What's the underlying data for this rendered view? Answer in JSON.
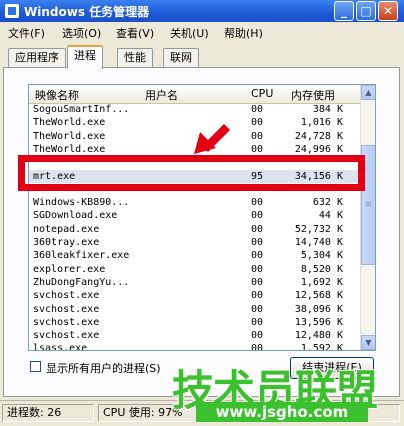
{
  "window": {
    "title": "Windows 任务管理器",
    "minimize_glyph": "_",
    "maximize_glyph": "□",
    "close_glyph": "✕"
  },
  "menu": [
    "文件(F)",
    "选项(O)",
    "查看(V)",
    "关机(U)",
    "帮助(H)"
  ],
  "tabs": [
    {
      "label": "应用程序",
      "active": false
    },
    {
      "label": "进程",
      "active": true
    },
    {
      "label": "性能",
      "active": false
    },
    {
      "label": "联网",
      "active": false
    }
  ],
  "columns": {
    "name": "映像名称",
    "user": "用户名",
    "cpu": "CPU",
    "mem": "内存使用"
  },
  "processes": [
    {
      "name": "SogouSmartInf...",
      "cpu": "00",
      "mem": "384 K"
    },
    {
      "name": "TheWorld.exe",
      "cpu": "00",
      "mem": "1,016 K"
    },
    {
      "name": "TheWorld.exe",
      "cpu": "00",
      "mem": "24,728 K"
    },
    {
      "name": "TheWorld.exe",
      "cpu": "00",
      "mem": "24,996 K"
    },
    {
      "name": "",
      "cpu": "",
      "mem": ""
    },
    {
      "name": "mrt.exe",
      "cpu": "95",
      "mem": "34,156 K",
      "selected": true
    },
    {
      "name": "",
      "cpu": "",
      "mem": ""
    },
    {
      "name": "Windows-KB890...",
      "cpu": "00",
      "mem": "632 K"
    },
    {
      "name": "SGDownload.exe",
      "cpu": "00",
      "mem": "44 K"
    },
    {
      "name": "notepad.exe",
      "cpu": "00",
      "mem": "52,732 K"
    },
    {
      "name": "360tray.exe",
      "cpu": "00",
      "mem": "14,740 K"
    },
    {
      "name": "360leakfixer.exe",
      "cpu": "00",
      "mem": "5,304 K"
    },
    {
      "name": "explorer.exe",
      "cpu": "00",
      "mem": "8,520 K"
    },
    {
      "name": "ZhuDongFangYu...",
      "cpu": "00",
      "mem": "1,692 K"
    },
    {
      "name": "svchost.exe",
      "cpu": "00",
      "mem": "12,568 K"
    },
    {
      "name": "svchost.exe",
      "cpu": "00",
      "mem": "38,096 K"
    },
    {
      "name": "svchost.exe",
      "cpu": "00",
      "mem": "13,596 K"
    },
    {
      "name": "svchost.exe",
      "cpu": "00",
      "mem": "12,480 K"
    },
    {
      "name": "lsass.exe",
      "cpu": "00",
      "mem": "1,592 K"
    }
  ],
  "show_all_users_label": "显示所有用户的进程(S)",
  "end_process_label": "结束进程(E)",
  "status": {
    "process_count": "进程数: 26",
    "cpu_usage": "CPU 使用: 97%",
    "commit": ""
  },
  "watermark": {
    "brand": "技术员联盟",
    "url": "www.jsgho.com"
  },
  "colors": {
    "highlight": "#E30013",
    "watermark_green": "#3CC12E",
    "title_blue": "#1E5BD6"
  }
}
